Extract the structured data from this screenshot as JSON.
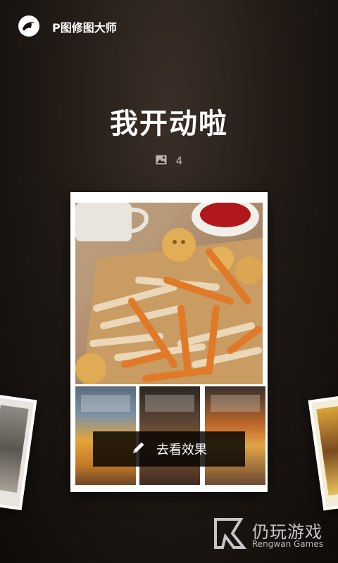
{
  "header": {
    "app_title": "P图修图大师",
    "logo_icon": "bird-logo-icon"
  },
  "album": {
    "title": "我开动啦",
    "photo_count": "4",
    "count_icon": "image-icon"
  },
  "cta": {
    "label": "去看效果",
    "icon": "pencil-icon"
  },
  "watermark": {
    "cn": "仍玩游戏",
    "en": "Rengwan Games"
  }
}
